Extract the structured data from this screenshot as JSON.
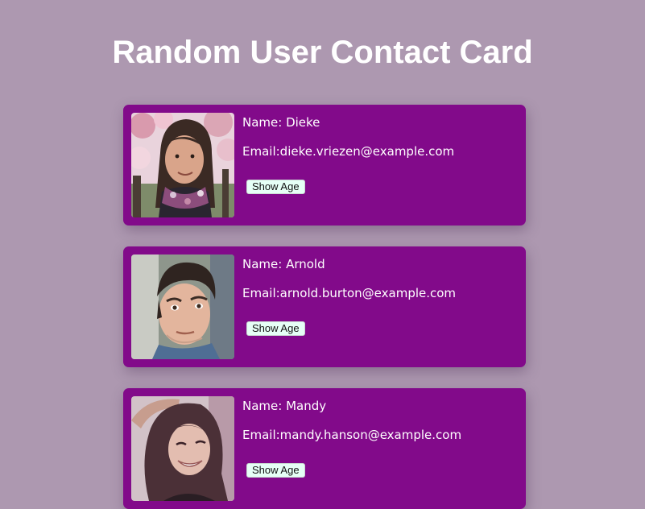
{
  "page": {
    "title": "Random User Contact Card"
  },
  "cards": [
    {
      "name_label": "Name: Dieke",
      "email_label": "Email:dieke.vriezen@example.com",
      "button_label": "Show Age"
    },
    {
      "name_label": "Name: Arnold",
      "email_label": "Email:arnold.burton@example.com",
      "button_label": "Show Age"
    },
    {
      "name_label": "Name: Mandy",
      "email_label": "Email:mandy.hanson@example.com",
      "button_label": "Show Age"
    }
  ],
  "colors": {
    "background": "#ad98b0",
    "card": "#820a8a",
    "button": "#e6fff6",
    "text": "#ffffff"
  }
}
